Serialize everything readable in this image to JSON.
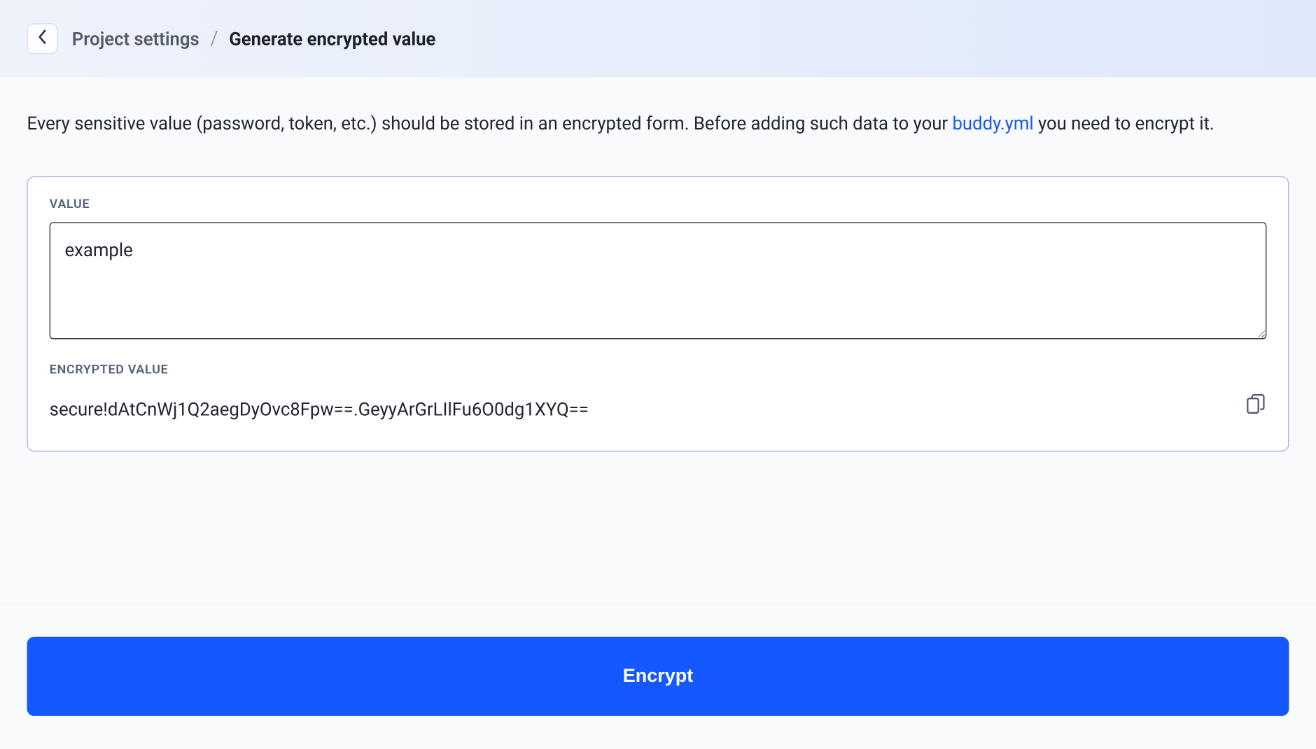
{
  "breadcrumb": {
    "parent": "Project settings",
    "current": "Generate encrypted value"
  },
  "description": {
    "before_link": "Every sensitive value (password, token, etc.) should be stored in an encrypted form. Before adding such data to your ",
    "link_text": "buddy.yml",
    "after_link": " you need to encrypt it."
  },
  "form": {
    "value_label": "VALUE",
    "value": "example",
    "encrypted_label": "ENCRYPTED VALUE",
    "encrypted_value": "secure!dAtCnWj1Q2aegDyOvc8Fpw==.GeyyArGrLIlFu6O0dg1XYQ=="
  },
  "actions": {
    "encrypt_label": "Encrypt"
  }
}
